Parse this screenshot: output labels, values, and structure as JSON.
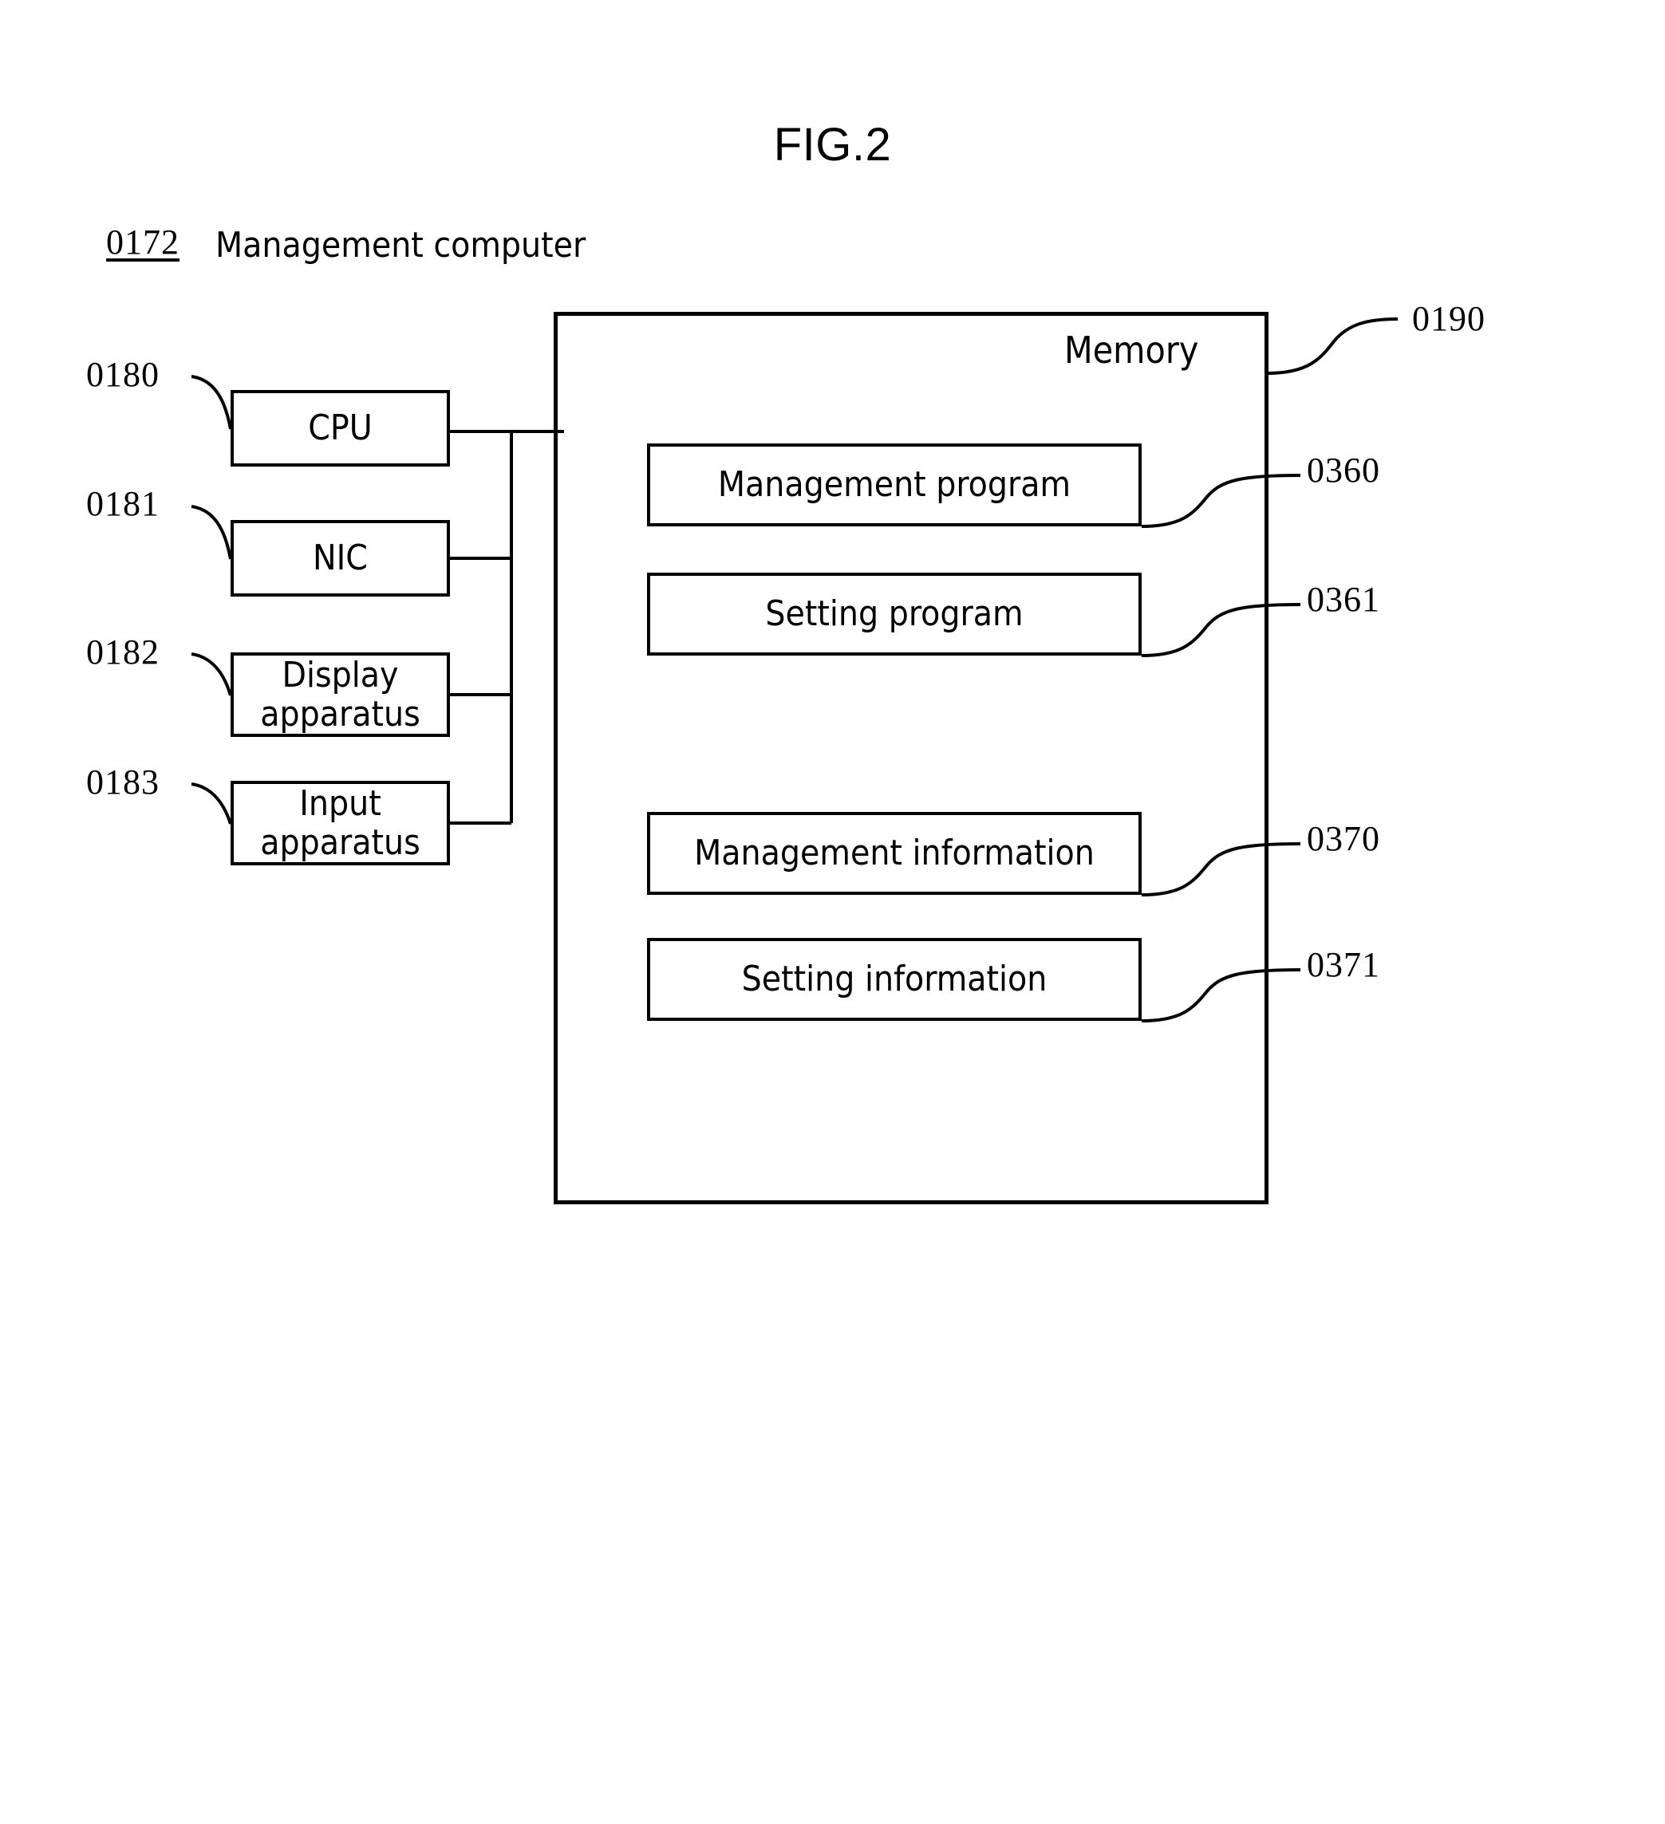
{
  "figure": {
    "title": "FIG.2",
    "subject_ref": "0172",
    "subject_label": "Management computer"
  },
  "components": [
    {
      "ref": "0180",
      "label": "CPU",
      "label_line2": ""
    },
    {
      "ref": "0181",
      "label": "NIC",
      "label_line2": ""
    },
    {
      "ref": "0182",
      "label": "Display",
      "label_line2": "apparatus"
    },
    {
      "ref": "0183",
      "label": "Input",
      "label_line2": "apparatus"
    }
  ],
  "memory": {
    "ref": "0190",
    "title": "Memory",
    "contents": [
      {
        "ref": "0360",
        "label": "Management program"
      },
      {
        "ref": "0361",
        "label": "Setting program"
      },
      {
        "ref": "0370",
        "label": "Management information"
      },
      {
        "ref": "0371",
        "label": "Setting information"
      }
    ]
  },
  "style": {
    "ink": "#000000",
    "paper": "#ffffff"
  }
}
